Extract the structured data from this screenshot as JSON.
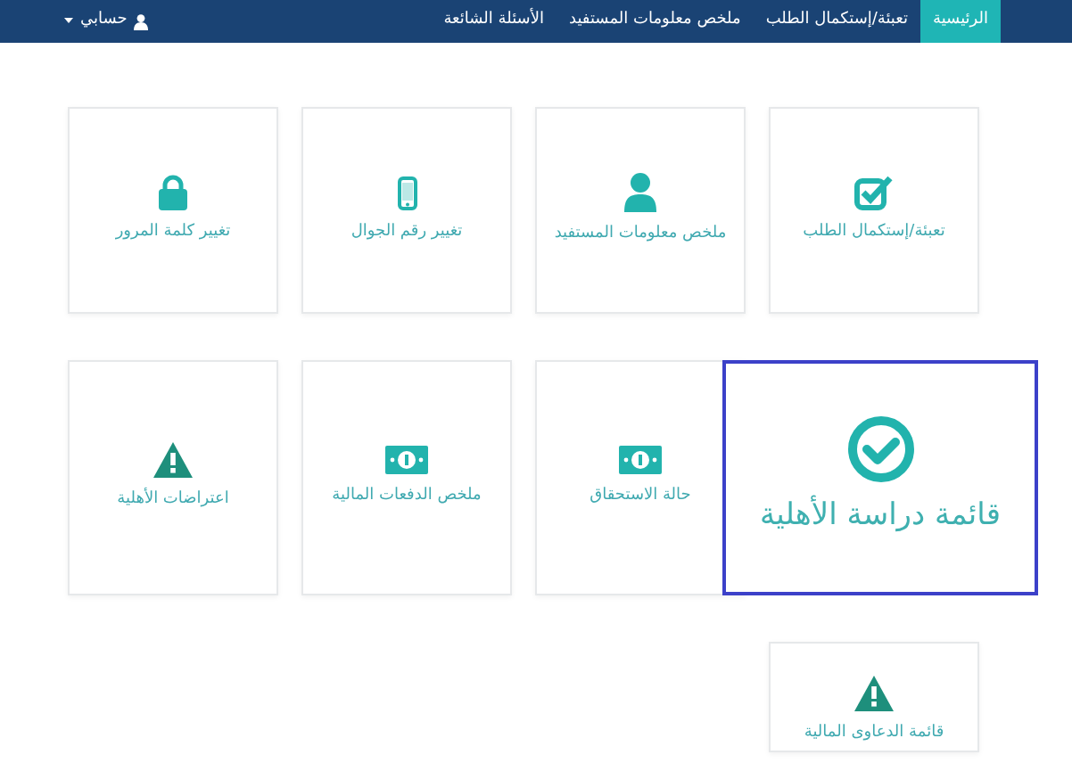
{
  "navbar": {
    "items": [
      {
        "label": "الرئيسية",
        "selected": true
      },
      {
        "label": "تعبئة/إستكمال الطلب",
        "selected": false
      },
      {
        "label": "ملخص معلومات المستفيد",
        "selected": false
      },
      {
        "label": "الأسئلة الشائعة",
        "selected": false
      }
    ],
    "account": {
      "label": "حسابي"
    }
  },
  "cards": [
    {
      "label": "تعبئة/إستكمال الطلب",
      "kind": "check-square",
      "highlighted": false
    },
    {
      "label": "ملخص معلومات المستفيد",
      "kind": "user",
      "highlighted": false
    },
    {
      "label": "تغيير رقم الجوال",
      "kind": "phone",
      "highlighted": false
    },
    {
      "label": "تغيير كلمة المرور",
      "kind": "lock",
      "highlighted": false
    },
    {
      "label": "قائمة دراسة الأهلية",
      "kind": "check-circle",
      "highlighted": true
    },
    {
      "label": "حالة الاستحقاق",
      "kind": "money",
      "highlighted": false
    },
    {
      "label": "ملخص الدفعات المالية",
      "kind": "money",
      "highlighted": false
    },
    {
      "label": "اعتراضات الأهلية",
      "kind": "warning",
      "highlighted": false
    },
    {
      "label": "قائمة الدعاوى المالية",
      "kind": "warning",
      "highlighted": false
    }
  ]
}
